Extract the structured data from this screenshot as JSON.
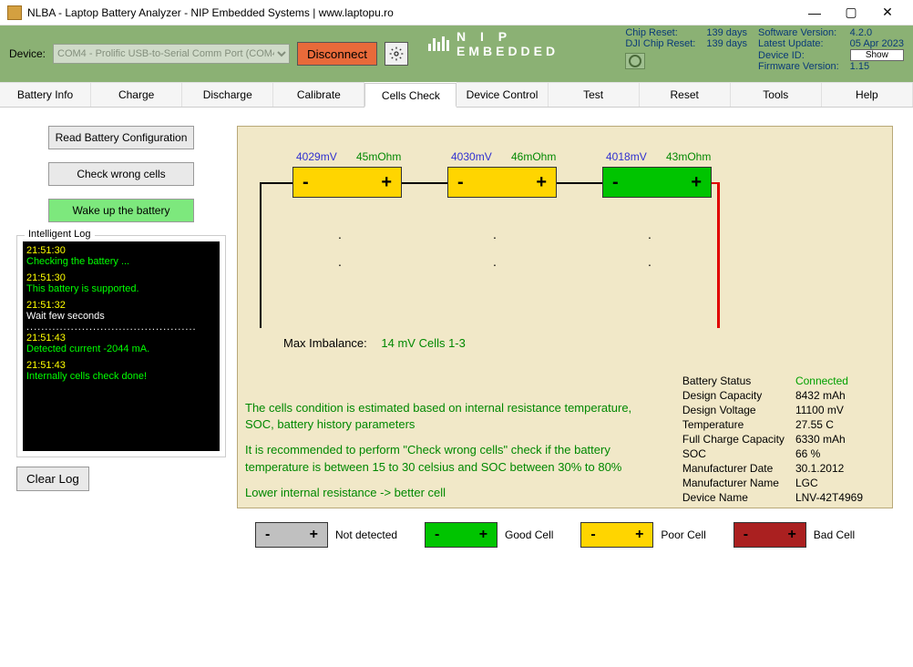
{
  "window": {
    "title": "NLBA - Laptop Battery Analyzer - NIP Embedded Systems | www.laptopu.ro"
  },
  "toolbar": {
    "device_label": "Device:",
    "device_value": "COM4 - Prolific USB-to-Serial Comm Port (COM4)",
    "disconnect": "Disconnect"
  },
  "header_info": {
    "chip_reset_k": "Chip Reset:",
    "chip_reset_v": "139 days",
    "dji_reset_k": "DJI Chip Reset:",
    "dji_reset_v": "139 days",
    "sw_ver_k": "Software Version:",
    "sw_ver_v": "4.2.0",
    "latest_k": "Latest Update:",
    "latest_v": "05 Apr 2023",
    "dev_id_k": "Device ID:",
    "show_btn": "Show",
    "fw_k": "Firmware Version:",
    "fw_v": "1.15"
  },
  "logo": {
    "top": "N I P",
    "bottom": "EMBEDDED"
  },
  "tabs": [
    "Battery Info",
    "Charge",
    "Discharge",
    "Calibrate",
    "Cells Check",
    "Device Control",
    "Test",
    "Reset",
    "Tools",
    "Help"
  ],
  "active_tab": 4,
  "buttons": {
    "read_config": "Read Battery Configuration",
    "check_wrong": "Check wrong cells",
    "wake": "Wake up the battery",
    "clear_log": "Clear Log"
  },
  "log_title": "Intelligent Log",
  "log": [
    {
      "t": "21:51:30",
      "msg": "Checking the battery ...",
      "cls": "msg-green"
    },
    {
      "t": "21:51:30",
      "msg": "This battery is supported.",
      "cls": "msg-green"
    },
    {
      "t": "21:51:32",
      "msg": "Wait few seconds",
      "cls": "msg-white"
    },
    {
      "dots": true
    },
    {
      "t": "21:51:43",
      "msg": "Detected current -2044 mA.",
      "cls": "msg-green"
    },
    {
      "t": "21:51:43",
      "msg": "Internally cells check done!",
      "cls": "msg-green"
    }
  ],
  "cells": [
    {
      "mv": "4029mV",
      "ohm": "45mOhm",
      "color": "yellow"
    },
    {
      "mv": "4030mV",
      "ohm": "46mOhm",
      "color": "yellow"
    },
    {
      "mv": "4018mV",
      "ohm": "43mOhm",
      "color": "green"
    }
  ],
  "imbalance": {
    "label": "Max Imbalance:",
    "value": "14 mV Cells 1-3"
  },
  "explain": {
    "p1": "The cells condition is estimated based on internal resistance temperature, SOC, battery history parameters",
    "p2": "It is recommended to perform \"Check wrong cells\" check if the battery temperature is between 15 to 30 celsius and SOC between 30% to 80%",
    "p3": "Lower internal resistance -> better cell"
  },
  "stats": {
    "status_k": "Battery Status",
    "status_v": "Connected",
    "dcap_k": "Design Capacity",
    "dcap_v": "8432 mAh",
    "dv_k": "Design Voltage",
    "dv_v": "11100 mV",
    "temp_k": "Temperature",
    "temp_v": "27.55 C",
    "fcc_k": "Full Charge Capacity",
    "fcc_v": "6330 mAh",
    "soc_k": "SOC",
    "soc_v": "66 %",
    "mdate_k": "Manufacturer Date",
    "mdate_v": "30.1.2012",
    "mname_k": "Manufacturer Name",
    "mname_v": "LGC",
    "dname_k": "Device Name",
    "dname_v": "LNV-42T4969"
  },
  "legend": {
    "not_detected": "Not detected",
    "good": "Good Cell",
    "poor": "Poor Cell",
    "bad": "Bad Cell"
  }
}
